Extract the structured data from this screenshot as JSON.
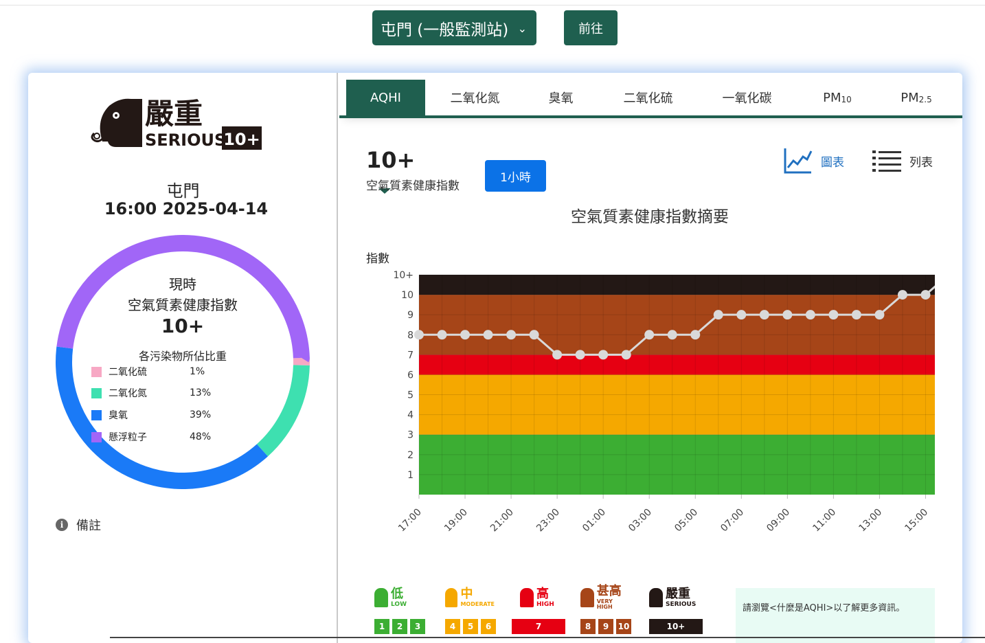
{
  "header": {
    "station_select": "屯門 (一般監測站)",
    "go_label": "前往"
  },
  "left": {
    "level_zh": "嚴重",
    "level_en": "SERIOUS",
    "level_value": "10+",
    "station": "屯門",
    "datetime": "16:00 2025-04-14",
    "donut_title1": "現時",
    "donut_title2": "空氣質素健康指數",
    "donut_value": "10+",
    "donut_sub": "各污染物所佔比重",
    "pollutants": [
      {
        "name": "二氧化硫",
        "pct": "1%",
        "value": 1,
        "color": "#f7a8c4"
      },
      {
        "name": "二氧化氮",
        "pct": "13%",
        "value": 13,
        "color": "#3ee0b0"
      },
      {
        "name": "臭氧",
        "pct": "39%",
        "value": 39,
        "color": "#1a7af7"
      },
      {
        "name": "懸浮粒子",
        "pct": "48%",
        "value": 48,
        "color": "#a166f7"
      }
    ],
    "notes_label": "備註",
    "info_icon_glyph": "i"
  },
  "tabs": [
    {
      "label": "AQHI",
      "sub": ""
    },
    {
      "label": "二氧化氮",
      "sub": ""
    },
    {
      "label": "臭氧",
      "sub": ""
    },
    {
      "label": "二氧化硫",
      "sub": ""
    },
    {
      "label": "一氧化碳",
      "sub": ""
    },
    {
      "label": "PM",
      "sub": "10"
    },
    {
      "label": "PM",
      "sub": "2.5"
    }
  ],
  "main": {
    "current_value": "10+",
    "current_label": "空氣質素健康指數",
    "hour_button": "1小時",
    "view_chart_label": "圖表",
    "view_list_label": "列表"
  },
  "chart_data": {
    "type": "line",
    "title": "空氣質素健康指數摘要",
    "ylabel": "指數",
    "ylim": [
      0,
      11
    ],
    "y_ticks": [
      "1",
      "2",
      "3",
      "4",
      "5",
      "6",
      "7",
      "8",
      "9",
      "10",
      "10+"
    ],
    "x_tick_labels": [
      "17:00",
      "19:00",
      "21:00",
      "23:00",
      "01:00",
      "03:00",
      "05:00",
      "07:00",
      "09:00",
      "11:00",
      "13:00",
      "15:00"
    ],
    "x": [
      "17:00",
      "18:00",
      "19:00",
      "20:00",
      "21:00",
      "22:00",
      "23:00",
      "00:00",
      "01:00",
      "02:00",
      "03:00",
      "04:00",
      "05:00",
      "06:00",
      "07:00",
      "08:00",
      "09:00",
      "10:00",
      "11:00",
      "12:00",
      "13:00",
      "14:00",
      "15:00",
      "16:00"
    ],
    "values": [
      8,
      8,
      8,
      8,
      8,
      8,
      7,
      7,
      7,
      7,
      8,
      8,
      8,
      9,
      9,
      9,
      9,
      9,
      9,
      9,
      9,
      10,
      10,
      11
    ],
    "bands": [
      {
        "from": 0,
        "to": 3,
        "color": "#3cae33"
      },
      {
        "from": 3,
        "to": 6,
        "color": "#f5a800"
      },
      {
        "from": 6,
        "to": 7,
        "color": "#e60012"
      },
      {
        "from": 7,
        "to": 10,
        "color": "#a64518"
      },
      {
        "from": 10,
        "to": 11,
        "color": "#231815"
      }
    ],
    "grid": true
  },
  "legend_bands": [
    {
      "zh": "低",
      "en": "LOW",
      "color": "#3cae33",
      "nums": [
        "1",
        "2",
        "3"
      ]
    },
    {
      "zh": "中",
      "en": "MODERATE",
      "color": "#f5a800",
      "nums": [
        "4",
        "5",
        "6"
      ]
    },
    {
      "zh": "高",
      "en": "HIGH",
      "color": "#e60012",
      "nums": [
        "7"
      ]
    },
    {
      "zh": "甚高",
      "en": "VERY HIGH",
      "color": "#a64518",
      "nums": [
        "8",
        "9",
        "10"
      ]
    },
    {
      "zh": "嚴重",
      "en": "SERIOUS",
      "color": "#231815",
      "nums": [
        "10+"
      ]
    }
  ],
  "info_text": "請瀏覽<什麼是AQHI>以了解更多資訊。"
}
